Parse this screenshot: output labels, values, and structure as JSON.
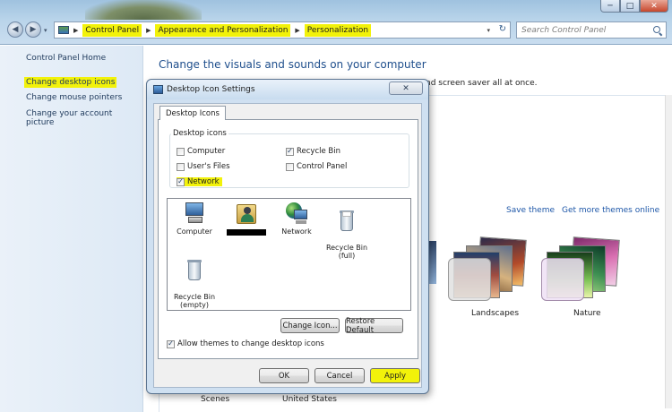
{
  "window": {
    "caption_buttons": {
      "minimize": "─",
      "maximize": "□",
      "close": "✕"
    }
  },
  "navigation": {
    "back_icon": "◀",
    "forward_icon": "▶",
    "dropdown_icon": "▾",
    "breadcrumbs": [
      "Control Panel",
      "Appearance and Personalization",
      "Personalization"
    ],
    "separator": "▶",
    "refresh_icon": "↻"
  },
  "search": {
    "placeholder": "Search Control Panel"
  },
  "sidebar": {
    "home": "Control Panel Home",
    "links": [
      "Change desktop icons",
      "Change mouse pointers",
      "Change your account picture"
    ]
  },
  "main": {
    "title": "Change the visuals and sounds on your computer",
    "subtext": "nd screen saver all at once.",
    "save_theme": "Save theme",
    "more_themes": "Get more themes online",
    "themes": [
      {
        "label": "Landscapes"
      },
      {
        "label": "Nature"
      },
      {
        "label": "Scenes"
      },
      {
        "label": "United States"
      }
    ]
  },
  "dialog": {
    "title": "Desktop Icon Settings",
    "close_glyph": "✕",
    "tab": "Desktop Icons",
    "group_label": "Desktop icons",
    "checkboxes": [
      {
        "label": "Computer",
        "checked": false
      },
      {
        "label": "Recycle Bin",
        "checked": true
      },
      {
        "label": "User's Files",
        "checked": false
      },
      {
        "label": "Control Panel",
        "checked": false
      },
      {
        "label": "Network",
        "checked": true
      }
    ],
    "check_glyph": "✓",
    "icons": [
      {
        "label": "Computer",
        "icon": "computer-icon"
      },
      {
        "label": "",
        "icon": "user-folder-icon"
      },
      {
        "label": "Network",
        "icon": "network-icon"
      },
      {
        "label": "Recycle Bin\n(full)",
        "icon": "recycle-bin-full-icon"
      },
      {
        "label": "Recycle Bin\n(empty)",
        "icon": "recycle-bin-empty-icon"
      }
    ],
    "change_icon": "Change Icon...",
    "restore_default": "Restore Default",
    "allow_themes": "Allow themes to change desktop icons",
    "allow_themes_checked": true,
    "ok": "OK",
    "cancel": "Cancel",
    "apply": "Apply"
  },
  "colors": {
    "highlight": "#f2f20a",
    "link": "#1e57a8",
    "title_text": "#1e4e8c"
  }
}
